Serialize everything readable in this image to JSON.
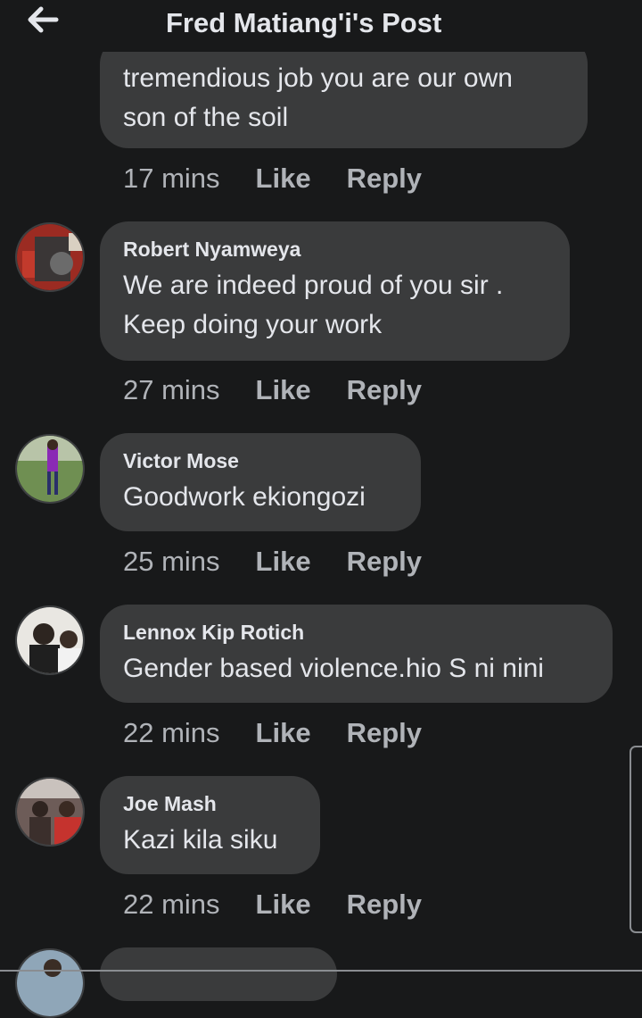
{
  "header": {
    "title": "Fred Matiang'i's Post",
    "back_icon": "arrow-left-icon"
  },
  "first_comment": {
    "text_lines": [
      "tremendious job you are our own",
      "son of the soil"
    ],
    "time": "17 mins",
    "like": "Like",
    "reply": "Reply"
  },
  "comments": [
    {
      "name": "Robert Nyamweya",
      "lines": [
        "We are indeed proud of you sir .",
        "Keep doing your work"
      ],
      "time": "27 mins",
      "like": "Like",
      "reply": "Reply"
    },
    {
      "name": "Victor Mose",
      "lines": [
        "Goodwork ekiongozi"
      ],
      "time": "25 mins",
      "like": "Like",
      "reply": "Reply"
    },
    {
      "name": "Lennox Kip Rotich",
      "lines": [
        "Gender based violence.hio S ni nini"
      ],
      "time": "22 mins",
      "like": "Like",
      "reply": "Reply"
    },
    {
      "name": "Joe Mash",
      "lines": [
        "Kazi kila siku"
      ],
      "time": "22 mins",
      "like": "Like",
      "reply": "Reply"
    }
  ],
  "colors": {
    "background": "#18191a",
    "bubble": "#3a3b3c",
    "meta": "#b0b3b8",
    "text": "#e4e6eb"
  }
}
